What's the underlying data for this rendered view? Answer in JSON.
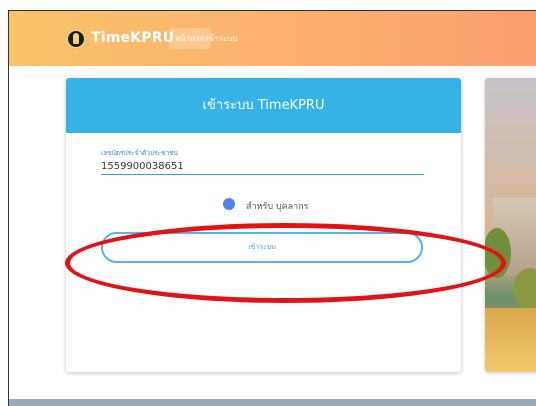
{
  "nav": {
    "brand": "TimeKPRU",
    "home": "หน้าแรก",
    "login": "เข้าระบบ"
  },
  "login": {
    "title": "เข้าระบบ TimeKPRU",
    "id_label": "เลขบัตรประจำตัวประชาชน",
    "id_value": "1559900038651",
    "radio_label": "สำหรับ บุคลากร",
    "button_label": "เข้าระบบ"
  },
  "colors": {
    "header": "#35b3e6",
    "button_border": "#57b2e6",
    "annotation": "#e01414"
  }
}
